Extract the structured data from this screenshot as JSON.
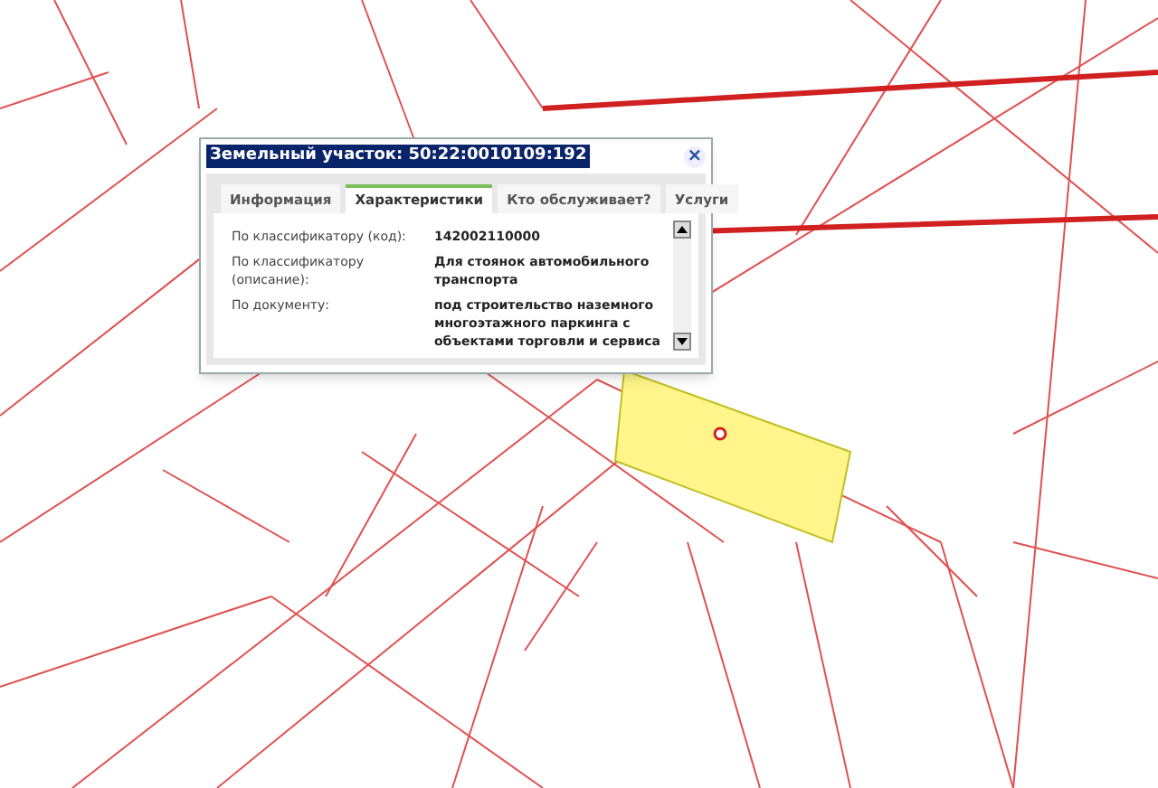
{
  "popup": {
    "title": "Земельный участок: 50:22:0010109:192",
    "close": "×",
    "tabs": [
      {
        "label": "Информация",
        "selected": false
      },
      {
        "label": "Характеристики",
        "selected": true
      },
      {
        "label": "Кто обслуживает?",
        "selected": false
      },
      {
        "label": "Услуги",
        "selected": false
      }
    ],
    "rows": [
      {
        "label": "По классификатору (код):",
        "value": "142002110000"
      },
      {
        "label": "По классификатору (описание):",
        "value": "Для стоянок автомобильного транспорта"
      },
      {
        "label": "По документу:",
        "value": "под строительство наземного многоэтажного паркинга с объектами торговли и сервиса"
      }
    ]
  }
}
